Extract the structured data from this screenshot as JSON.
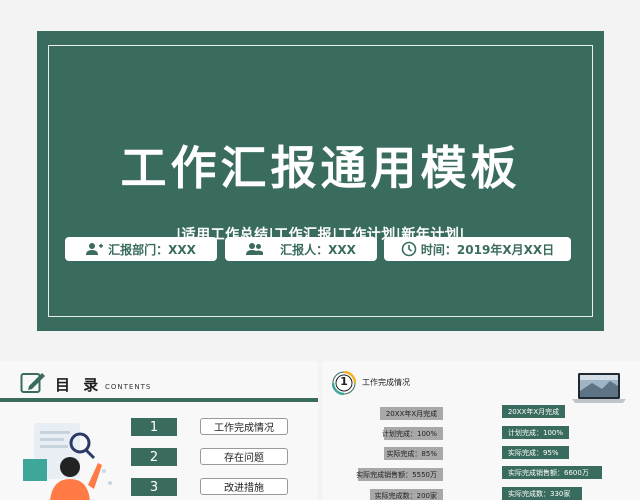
{
  "hero": {
    "title": "工作汇报通用模板",
    "subtitle": "|适用工作总结|工作汇报|工作计划|新年计划|",
    "info": [
      {
        "icon": "user-plus-icon",
        "text": "汇报部门：XXX"
      },
      {
        "icon": "users-icon",
        "text": "汇报人：XXX"
      },
      {
        "icon": "clock-icon",
        "text": "时间：2019年X月XX日"
      }
    ]
  },
  "toc": {
    "title": "目 录",
    "subtitle": "CONTENTS",
    "items": [
      {
        "num": "1",
        "label": "工作完成情况"
      },
      {
        "num": "2",
        "label": "存在问题"
      },
      {
        "num": "3",
        "label": "改进措施"
      }
    ]
  },
  "section": {
    "number": "1",
    "title": "工作完成情况",
    "left": {
      "header": "20XX年X月完成",
      "rows": [
        "计划完成：100%",
        "实际完成：85%",
        "实际完成销售额：5550万",
        "实际完成数：200家"
      ]
    },
    "right": {
      "header": "20XX年X月完成",
      "rows": [
        "计划完成：100%",
        "实际完成：95%",
        "实际完成销售额：6600万",
        "实际完成数：330家"
      ]
    }
  },
  "colors": {
    "accent": "#3a6b5f",
    "grey_bar": "#a8a8a8",
    "background": "#f3f3f3"
  }
}
